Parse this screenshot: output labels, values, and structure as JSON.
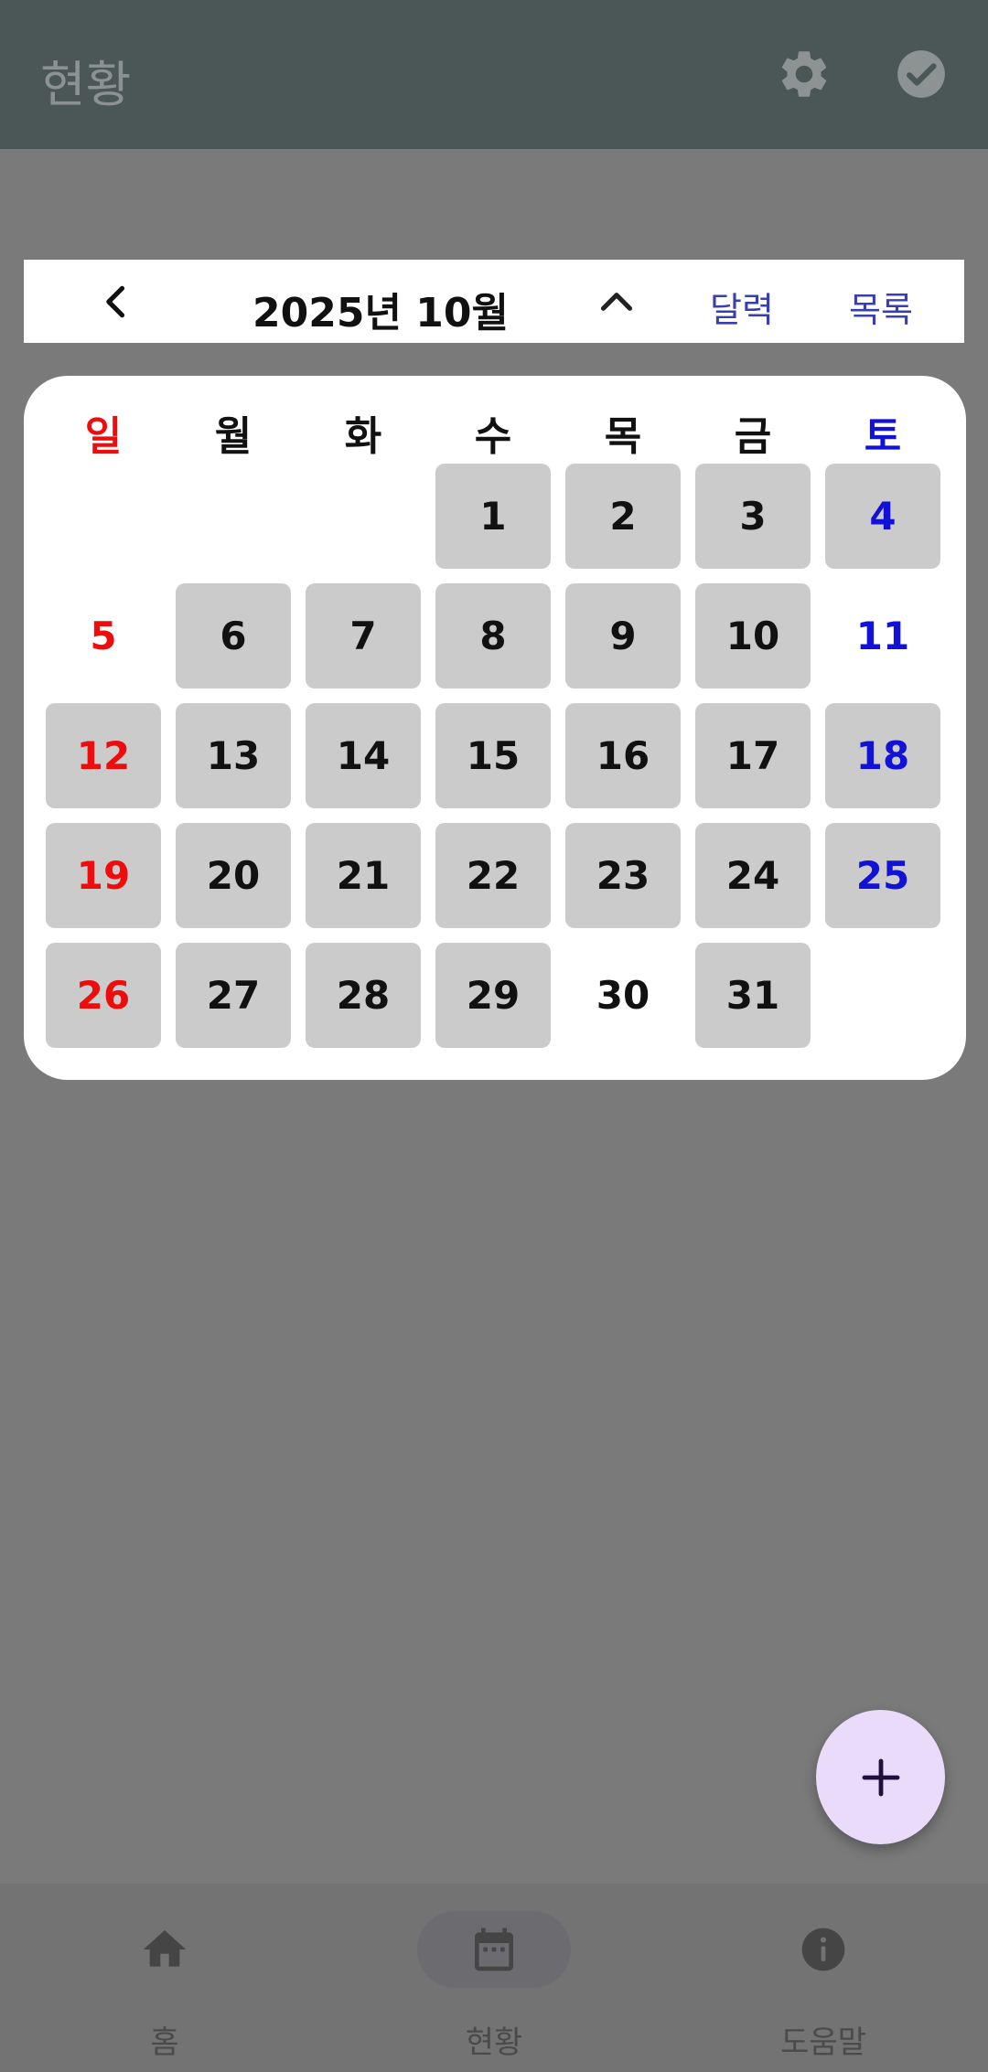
{
  "appbar": {
    "title": "현황",
    "actions": [
      {
        "icon": "gear-icon"
      },
      {
        "icon": "check-circle-icon"
      }
    ]
  },
  "month_bar": {
    "prev_icon": "chevron-left-icon",
    "title": "2025년 10월",
    "collapse_icon": "chevron-up-icon",
    "tab_calendar": "달력",
    "tab_list": "목록"
  },
  "calendar": {
    "weekdays": [
      "일",
      "월",
      "화",
      "수",
      "목",
      "금",
      "토"
    ],
    "weeks": [
      [
        "",
        "",
        "",
        "1",
        "2",
        "3",
        "4"
      ],
      [
        "5",
        "6",
        "7",
        "8",
        "9",
        "10",
        "11"
      ],
      [
        "12",
        "13",
        "14",
        "15",
        "16",
        "17",
        "18"
      ],
      [
        "19",
        "20",
        "21",
        "22",
        "23",
        "24",
        "25"
      ],
      [
        "26",
        "27",
        "28",
        "29",
        "30",
        "31",
        ""
      ]
    ],
    "unmarked_days": [
      "5",
      "11",
      "30"
    ],
    "colors": {
      "sunday": "#ee0d0d",
      "saturday": "#1212d6",
      "marked_cell": "#cbcbcb"
    }
  },
  "fab": {
    "icon": "plus-icon"
  },
  "bottom_nav": {
    "items": [
      {
        "label": "홈",
        "icon": "home-icon"
      },
      {
        "label": "현황",
        "icon": "calendar-icon",
        "active": true
      },
      {
        "label": "도움말",
        "icon": "info-icon"
      }
    ]
  }
}
